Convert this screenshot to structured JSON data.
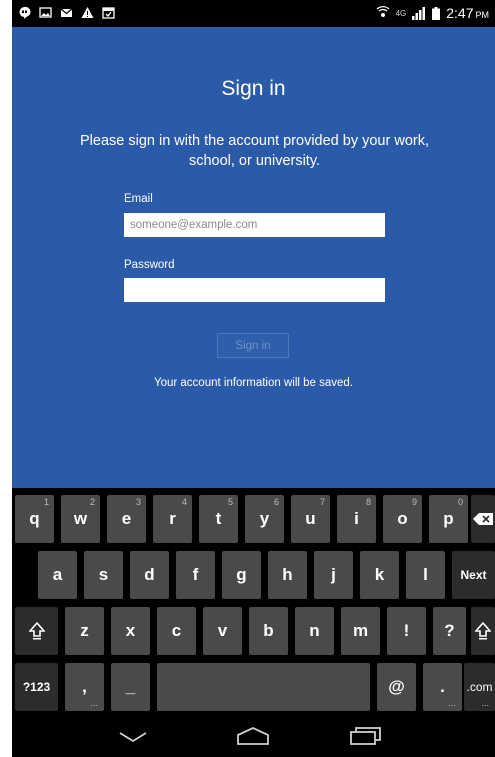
{
  "status_bar": {
    "left_icons": [
      "hangouts-icon",
      "gallery-icon",
      "gmail-icon",
      "warning-icon",
      "calendar-icon"
    ],
    "network": "4G",
    "time": "2:47",
    "ampm": "PM"
  },
  "signin": {
    "title": "Sign in",
    "subtitle": "Please sign in with the account provided by your work, school, or university.",
    "email_label": "Email",
    "email_placeholder": "someone@example.com",
    "email_value": "",
    "password_label": "Password",
    "password_value": "",
    "button_label": "Sign in",
    "note": "Your account information will be saved."
  },
  "keyboard": {
    "row1": [
      {
        "label": "q",
        "hint": "1"
      },
      {
        "label": "w",
        "hint": "2"
      },
      {
        "label": "e",
        "hint": "3"
      },
      {
        "label": "r",
        "hint": "4"
      },
      {
        "label": "t",
        "hint": "5"
      },
      {
        "label": "y",
        "hint": "6"
      },
      {
        "label": "u",
        "hint": "7"
      },
      {
        "label": "i",
        "hint": "8"
      },
      {
        "label": "o",
        "hint": "9"
      },
      {
        "label": "p",
        "hint": "0"
      }
    ],
    "row2": [
      "a",
      "s",
      "d",
      "f",
      "g",
      "h",
      "j",
      "k",
      "l"
    ],
    "next_label": "Next",
    "row3": [
      "z",
      "x",
      "c",
      "v",
      "b",
      "n",
      "m",
      "!",
      "?"
    ],
    "symbols_label": "?123",
    "comma_label": ",",
    "underscore_label": "_",
    "at_label": "@",
    "period_label": ".",
    "com_label": ".com",
    "dots_label": "..."
  },
  "nav_bar": {
    "icons": [
      "back-icon",
      "home-icon",
      "recents-icon"
    ]
  }
}
